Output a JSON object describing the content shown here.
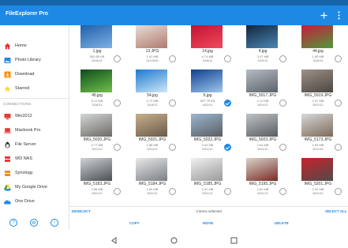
{
  "app": {
    "title": "FileExplorer Pro",
    "accent": "#1e88e5",
    "actions": [
      {
        "name": "add-icon",
        "glyph": "+"
      },
      {
        "name": "more-vert-icon",
        "glyph": "⋮"
      }
    ]
  },
  "sidebar": {
    "items": [
      {
        "label": "Home",
        "icon": "home-icon",
        "color": "#e53935"
      },
      {
        "label": "Photo Library",
        "icon": "photo-library-icon",
        "color": "#1e88e5"
      },
      {
        "label": "Download",
        "icon": "download-icon",
        "color": "#fb8c00"
      },
      {
        "label": "Starred",
        "icon": "star-icon",
        "color": "#fdd835"
      }
    ],
    "connections_title": "CONNECTIONS",
    "connections": [
      {
        "label": "Win2012",
        "icon": "windows-pc-icon",
        "color": "#e53935"
      },
      {
        "label": "Macbook Pro",
        "icon": "mac-icon",
        "color": "#e53935"
      },
      {
        "label": "File Server",
        "icon": "linux-server-icon",
        "color": "#333333"
      },
      {
        "label": "WD NAS",
        "icon": "nas-icon",
        "color": "#e53935"
      },
      {
        "label": "Synology",
        "icon": "synology-icon",
        "color": "#fb8c00"
      },
      {
        "label": "My Google Drive",
        "icon": "google-drive-icon",
        "color": "#43a047"
      },
      {
        "label": "One Drive",
        "icon": "onedrive-icon",
        "color": "#1e88e5"
      }
    ],
    "footer_icons": [
      "help-icon",
      "settings-icon",
      "info-icon"
    ]
  },
  "files": [
    {
      "name": "1.jpg",
      "size": "552.65 KB",
      "date": "5/18/13",
      "selected": false,
      "colors": [
        "#1f5fa8",
        "#7fb2e6"
      ]
    },
    {
      "name": "13.JPG",
      "size": "1.61 MB",
      "date": "11/15/09",
      "selected": false,
      "colors": [
        "#e8dcd4",
        "#b07b6f"
      ]
    },
    {
      "name": "14.jpg",
      "size": "4.74 MB",
      "date": "3/18/11",
      "selected": false,
      "colors": [
        "#c3122e",
        "#f04a5e"
      ]
    },
    {
      "name": "4.jpg",
      "size": "3.47 MB",
      "date": "4/22/11",
      "selected": false,
      "colors": [
        "#10263d",
        "#4d86b4"
      ]
    },
    {
      "name": "44.jpg",
      "size": "1.65 MB",
      "date": "3/18/11",
      "selected": false,
      "colors": [
        "#c81c38",
        "#4f9a3c"
      ]
    },
    {
      "name": "45.jpg",
      "size": "5.11 MB",
      "date": "3/18/11",
      "selected": false,
      "colors": [
        "#0d4c1c",
        "#71c24a"
      ]
    },
    {
      "name": "54.jpg",
      "size": "2.72 MB",
      "date": "3/18/11",
      "selected": false,
      "colors": [
        "#1a7ad0",
        "#cfe7f7"
      ]
    },
    {
      "name": "6.jpg",
      "size": "557.78 KB",
      "date": "4/22/11",
      "selected": true,
      "colors": [
        "#0d3f8f",
        "#9fc7ee"
      ]
    },
    {
      "name": "IMG_5017.JPG",
      "size": "2.11 MB",
      "date": "5/01/12",
      "selected": false,
      "colors": [
        "#b5bcc4",
        "#5b626a"
      ]
    },
    {
      "name": "IMG_5019.JPG",
      "size": "2.47 MB",
      "date": "5/01/12",
      "selected": false,
      "colors": [
        "#9e9187",
        "#4c4641"
      ]
    },
    {
      "name": "IMG_5020.JPG",
      "size": "3.77 MB",
      "date": "5/01/12",
      "selected": false,
      "colors": [
        "#d4d7d8",
        "#6c6a63"
      ]
    },
    {
      "name": "IMG_5021.JPG",
      "size": "2.88 MB",
      "date": "5/01/12",
      "selected": false,
      "colors": [
        "#c7b08c",
        "#6a5a48"
      ]
    },
    {
      "name": "IMG_5022.JPG",
      "size": "3.04 MB",
      "date": "5/01/12",
      "selected": true,
      "colors": [
        "#9bb6d1",
        "#5a5e62"
      ]
    },
    {
      "name": "IMG_5023.JPG",
      "size": "2.64 MB",
      "date": "5/01/12",
      "selected": false,
      "colors": [
        "#bfc3c5",
        "#595d60"
      ]
    },
    {
      "name": "IMG_5173.JPG",
      "size": "2.93 MB",
      "date": "5/01/12",
      "selected": false,
      "colors": [
        "#d8d8d8",
        "#7d6a5a"
      ]
    },
    {
      "name": "IMG_5183.JPG",
      "size": "2.88 MB",
      "date": "5/01/12",
      "selected": false,
      "colors": [
        "#cfd3d6",
        "#4b4f52"
      ]
    },
    {
      "name": "IMG_5184.JPG",
      "size": "2.65 MB",
      "date": "5/01/12",
      "selected": false,
      "colors": [
        "#e8e9ea",
        "#7b7f83"
      ]
    },
    {
      "name": "IMG_5185.JPG",
      "size": "1.87 MB",
      "date": "5/01/12",
      "selected": false,
      "colors": [
        "#f0f0f0",
        "#9a9a9a"
      ]
    },
    {
      "name": "IMG_5195.JPG",
      "size": "2.62 MB",
      "date": "5/01/12",
      "selected": false,
      "colors": [
        "#d9d4cc",
        "#7a2a24"
      ]
    },
    {
      "name": "IMG_5201.JPG",
      "size": "2.92 MB",
      "date": "5/01/12",
      "selected": false,
      "colors": [
        "#c8222a",
        "#4f4b49"
      ]
    }
  ],
  "selection": {
    "deselect_label": "DESELECT",
    "status": "3 items selected",
    "select_all_label": "SELECT ALL"
  },
  "actions": {
    "copy_label": "COPY",
    "move_label": "MOVE",
    "delete_label": "DELETE"
  },
  "navbar": [
    "back-icon",
    "home-circle-icon",
    "recents-icon"
  ]
}
